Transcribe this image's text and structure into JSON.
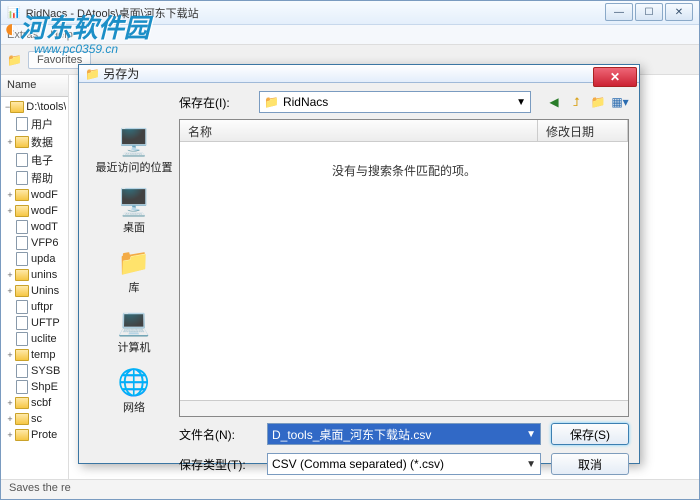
{
  "main": {
    "title": "RidNacs - DAtools\\桌面\\河东下载站",
    "menu": {
      "extras": "Extras",
      "help": "Help"
    },
    "favorites_label": "Favorites",
    "name_header": "Name",
    "path_row": "D:\\tools\\",
    "tree": [
      {
        "exp": "",
        "icon": "file",
        "label": "用户"
      },
      {
        "exp": "+",
        "icon": "folder",
        "label": "数据"
      },
      {
        "exp": "",
        "icon": "file",
        "label": "电子"
      },
      {
        "exp": "",
        "icon": "file",
        "label": "帮助"
      },
      {
        "exp": "+",
        "icon": "folder",
        "label": "wodF"
      },
      {
        "exp": "+",
        "icon": "folder",
        "label": "wodF"
      },
      {
        "exp": "",
        "icon": "file",
        "label": "wodT"
      },
      {
        "exp": "",
        "icon": "file",
        "label": "VFP6"
      },
      {
        "exp": "",
        "icon": "file",
        "label": "upda"
      },
      {
        "exp": "+",
        "icon": "folder",
        "label": "unins"
      },
      {
        "exp": "+",
        "icon": "folder",
        "label": "Unins"
      },
      {
        "exp": "",
        "icon": "file",
        "label": "uftpr"
      },
      {
        "exp": "",
        "icon": "file",
        "label": "UFTP"
      },
      {
        "exp": "",
        "icon": "file",
        "label": "uclite"
      },
      {
        "exp": "+",
        "icon": "folder",
        "label": "temp"
      },
      {
        "exp": "",
        "icon": "file",
        "label": "SYSB"
      },
      {
        "exp": "",
        "icon": "file",
        "label": "ShpE"
      },
      {
        "exp": "+",
        "icon": "folder",
        "label": "scbf"
      },
      {
        "exp": "+",
        "icon": "folder",
        "label": "sc"
      },
      {
        "exp": "+",
        "icon": "folder",
        "label": "Prote"
      }
    ],
    "status": "Saves the re"
  },
  "watermark": {
    "title": "河东软件园",
    "url": "www.pc0359.cn"
  },
  "dialog": {
    "title": "另存为",
    "savein_label": "保存在(I):",
    "savein_value": "RidNacs",
    "file_cols": {
      "name": "名称",
      "date": "修改日期"
    },
    "empty_text": "没有与搜索条件匹配的项。",
    "places": [
      {
        "icon": "🖥️",
        "label": "最近访问的位置"
      },
      {
        "icon": "🖥️",
        "label": "桌面"
      },
      {
        "icon": "📁",
        "label": "库"
      },
      {
        "icon": "💻",
        "label": "计算机"
      },
      {
        "icon": "🌐",
        "label": "网络"
      }
    ],
    "filename_label": "文件名(N):",
    "filename_value": "D_tools_桌面_河东下载站.csv",
    "filetype_label": "保存类型(T):",
    "filetype_value": "CSV (Comma separated) (*.csv)",
    "save_btn": "保存(S)",
    "cancel_btn": "取消"
  }
}
